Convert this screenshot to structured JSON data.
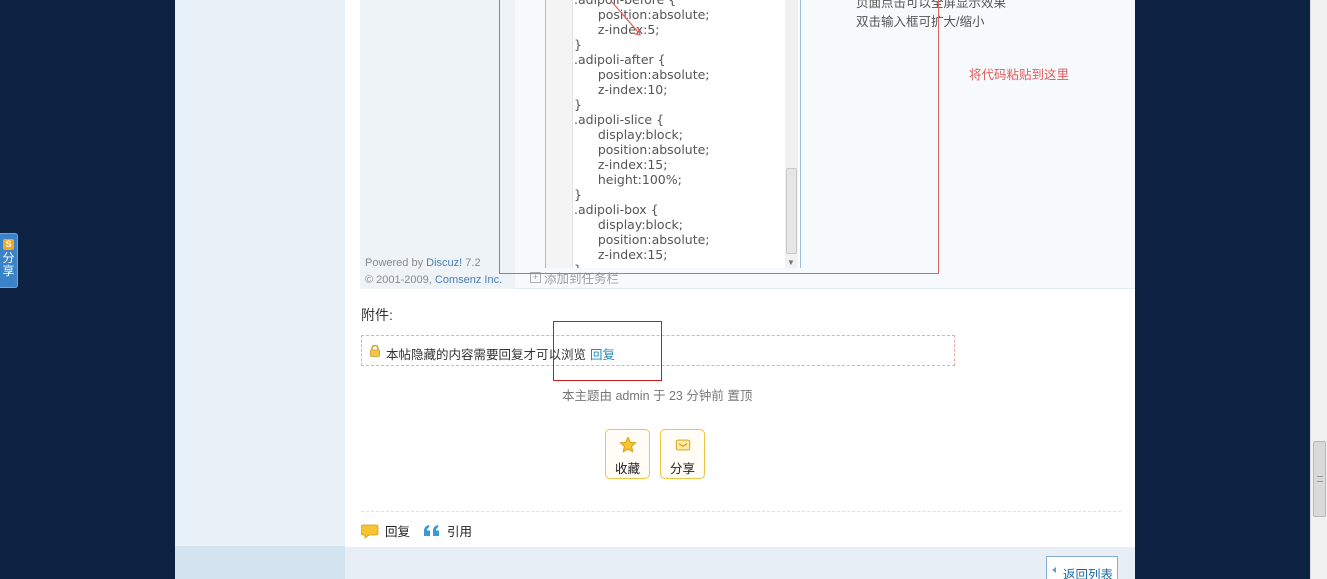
{
  "share_widget": {
    "logo": "S",
    "label": "分享"
  },
  "embed": {
    "powered_by_prefix": "Powered by",
    "powered_by_brand": "Discuz!",
    "powered_by_version": "7.2",
    "copyright_prefix": "© 2001-2009,",
    "copyright_company": "Comsenz Inc.",
    "code_lines": ".adipoli-before {\n      position:absolute;\n      z-index:5;\n}\n.adipoli-after {\n      position:absolute;\n      z-index:10;\n}\n.adipoli-slice {\n      display:block;\n      position:absolute;\n      z-index:15;\n      height:100%;\n}\n.adipoli-box {\n      display:block;\n      position:absolute;\n      z-index:15;\n}",
    "hint_top": "页面点击可以全屏显示效果",
    "hint_resize": "双击输入框可扩大/缩小",
    "paste_note": "将代码粘贴到这里",
    "add_to_taskbar": "添加到任务栏"
  },
  "attachments": {
    "title": "附件:",
    "hidden_notice": "本帖隐藏的内容需要回复才可以浏览",
    "reply_link": "回复"
  },
  "sticky_note": "本主题由 admin 于 23 分钟前 置顶",
  "actions": {
    "favorite_label": "收藏",
    "share_label": "分享"
  },
  "post_actions": {
    "reply_label": "回复",
    "quote_label": "引用"
  },
  "back_to_list": "返回列表",
  "colors": {
    "background": "#0d2143",
    "accent_red": "#d11818",
    "link_blue": "#1b8ab8",
    "button_border": "#f2c443"
  }
}
